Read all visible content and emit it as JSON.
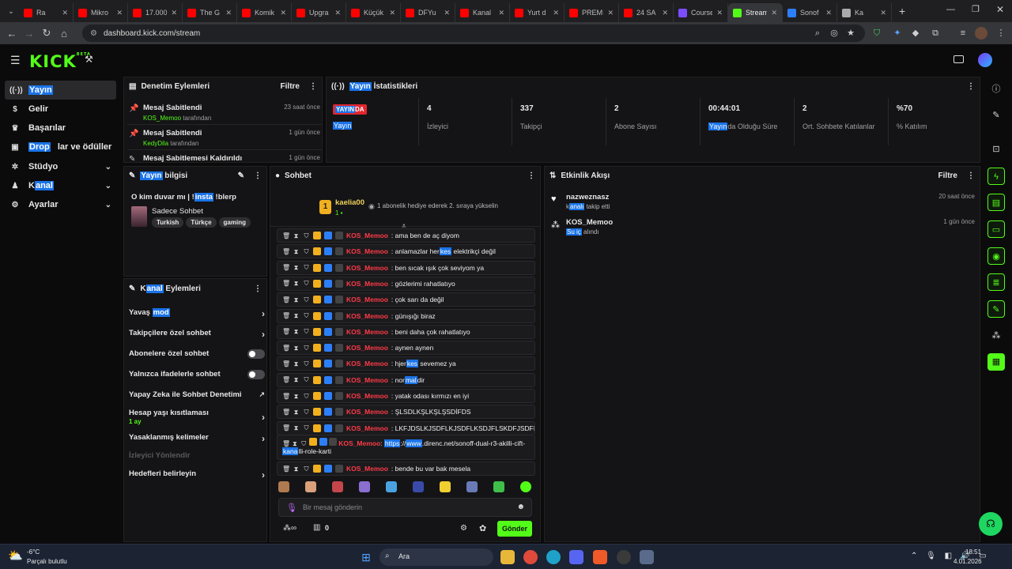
{
  "browser": {
    "tabs": [
      {
        "label": "Ra",
        "color": "#ff0000"
      },
      {
        "label": "Mikro",
        "color": "#ff0000"
      },
      {
        "label": "17.000",
        "color": "#ff0000"
      },
      {
        "label": "The G",
        "color": "#ff0000"
      },
      {
        "label": "Komik",
        "color": "#ff0000"
      },
      {
        "label": "Upgra",
        "color": "#ff0000"
      },
      {
        "label": "Küçük",
        "color": "#ff0000"
      },
      {
        "label": "DFYu",
        "color": "#ff0000"
      },
      {
        "label": "Kanal",
        "color": "#ff0000"
      },
      {
        "label": "Yurt d",
        "color": "#ff0000"
      },
      {
        "label": "PREMI",
        "color": "#ff0000"
      },
      {
        "label": "24 SA",
        "color": "#ff0000"
      },
      {
        "label": "Course",
        "color": "#7c4dff"
      },
      {
        "label": "Stream",
        "color": "#53fc18"
      },
      {
        "label": "Sonof",
        "color": "#2d7ff9"
      },
      {
        "label": "Ka",
        "color": "#aaaaaa"
      }
    ],
    "active_tab_index": 13,
    "url": "dashboard.kick.com/stream"
  },
  "kick": {
    "logo": "KICK",
    "beta": "BETA"
  },
  "leftnav": {
    "items": [
      {
        "label": "Yayın",
        "icon": "broadcast-icon"
      },
      {
        "label": "Gelir",
        "icon": "dollar-icon"
      },
      {
        "label": "Başarılar",
        "icon": "trophy-icon"
      },
      {
        "label_hl": "Drop",
        "label_rest": "lar ve ödüller",
        "icon": "gift-icon"
      },
      {
        "label": "Stüdyo",
        "icon": "settings-icon"
      },
      {
        "label_pre": "K",
        "label_hl": "anal",
        "icon": "user-icon"
      },
      {
        "label": "Ayarlar",
        "icon": "gear-icon"
      }
    ]
  },
  "audit": {
    "title": "Denetim Eylemleri",
    "filter": "Filtre",
    "items": [
      {
        "title": "Mesaj Sabitlendi",
        "user": "KOS_Memoo",
        "by": "tarafından",
        "time": "23 saat önce"
      },
      {
        "title": "Mesaj Sabitlendi",
        "user": "KedyDila",
        "by": "tarafından",
        "time": "1 gün önce"
      },
      {
        "title": "Mesaj Sabitlemesi Kaldırıldı",
        "user": "",
        "by": "",
        "time": "1 gün önce"
      }
    ]
  },
  "stats": {
    "title_hl": "Yayın",
    "title_rest": " İstatistikleri",
    "live_hl": "YAYIN",
    "live_rest": "DA",
    "live_label": "Yayın",
    "items": [
      {
        "value": "4",
        "label": "İzleyici"
      },
      {
        "value": "337",
        "label": "Takipçi"
      },
      {
        "value": "2",
        "label": "Abone Sayısı"
      },
      {
        "value": "00:44:01",
        "label_hl": "Yayın",
        "label_rest": "da Olduğu Süre"
      },
      {
        "value": "2",
        "label": "Ort. Sohbete Katılanlar"
      },
      {
        "value": "%70",
        "label": "% Katılım"
      }
    ]
  },
  "streaminfo": {
    "title_hl": "Yayın",
    "title_rest": " bilgisi",
    "stream_title_pre": "O kim duvar mı | !",
    "stream_title_hl": "insta",
    "stream_title_post": " !blerp",
    "category": "Sadece Sohbet",
    "tags": [
      "Turkish",
      "Türkçe",
      "gaming"
    ]
  },
  "channel_actions": {
    "title_pre": "K",
    "title_hl": "anal",
    "title_rest": " Eylemleri",
    "items": [
      {
        "pre": "Yavaş ",
        "hl": "mod",
        "type": "arrow"
      },
      {
        "label": "Takipçilere özel sohbet",
        "type": "arrow"
      },
      {
        "label": "Abonelere özel sohbet",
        "type": "toggle"
      },
      {
        "label": "Yalnızca ifadelerle sohbet",
        "type": "toggle"
      },
      {
        "label": "Yapay Zeka ile Sohbet Denetimi",
        "type": "ext"
      },
      {
        "label": "Hesap yaşı kısıtlaması",
        "sub": "1 ay",
        "type": "arrow"
      },
      {
        "label": "Yasaklanmış kelimeler",
        "type": "arrow"
      },
      {
        "label": "İzleyici Yönlendir",
        "type": "disabled"
      },
      {
        "label": "Hedefleri belirleyin",
        "type": "arrow"
      }
    ]
  },
  "chat": {
    "title": "Sohbet",
    "pinned_user": "kaelia00",
    "pinned_badge": "1",
    "pinned_msg": "1 abonelik hediye ederek 2. sıraya yükselin",
    "messages": [
      {
        "user": "KOS_Memoo",
        "text": "ama ben de aç diyom"
      },
      {
        "user": "KOS_Memoo",
        "pre": "anlamazlar her",
        "hl": "kes",
        "post": " elektrikçi değil"
      },
      {
        "user": "KOS_Memoo",
        "text": "ben sıcak ışık çok seviyom ya"
      },
      {
        "user": "KOS_Memoo",
        "text": "gözlerimi rahatlatıyo"
      },
      {
        "user": "KOS_Memoo",
        "text": "çok sarı da değil"
      },
      {
        "user": "KOS_Memoo",
        "text": "günışığı biraz"
      },
      {
        "user": "KOS_Memoo",
        "text": "beni daha çok rahatlatıyo"
      },
      {
        "user": "KOS_Memoo",
        "text": "aynen aynen"
      },
      {
        "user": "KOS_Memoo",
        "pre": "hjer",
        "hl": "kes",
        "post": " sevemez ya"
      },
      {
        "user": "KOS_Memoo",
        "pre": "nor",
        "hl": "mal",
        "post": "dir"
      },
      {
        "user": "KOS_Memoo",
        "text": "yatak odası kırmızı en iyi"
      },
      {
        "user": "KOS_Memoo",
        "text": "ŞLSDLKŞLKŞLŞSDİFDS"
      },
      {
        "user": "KOS_Memoo",
        "text": "LKFJDSLKJSDFLKJSDFLKSDJFLSKDFJSDFL"
      }
    ],
    "link_msg": {
      "user": "KOS_Memoo",
      "l1_hl1": "https",
      "l1_mid": "://",
      "l1_hl2": "www",
      "l1_rest": ".direnc.net/sonoff-dual-r3-akilli-cift-",
      "l2_hl": "kana",
      "l2_rest": "lli-role-karti"
    },
    "last_msg": {
      "user": "KOS_Memoo",
      "text": "bende bu var bak mesela"
    },
    "input_placeholder": "Bir mesaj gönderin",
    "points": "0",
    "send": "Gönder"
  },
  "activity": {
    "title": "Etkinlik Akışı",
    "filter": "Filtre",
    "items": [
      {
        "user": "nazweznasz",
        "pre": "k",
        "hl": "analı",
        "post": " takip etti",
        "time": "20 saat önce",
        "icon": "heart-icon"
      },
      {
        "user": "KOS_Memoo",
        "pre": "",
        "hl": "Su iç",
        "post": " alındı",
        "time": "1 gün önce",
        "icon": "reward-icon"
      }
    ]
  },
  "taskbar": {
    "temp": "-6°C",
    "weather": "Parçalı bulutlu",
    "search": "Ara",
    "time": "18:51",
    "date": "4.01.2026"
  }
}
